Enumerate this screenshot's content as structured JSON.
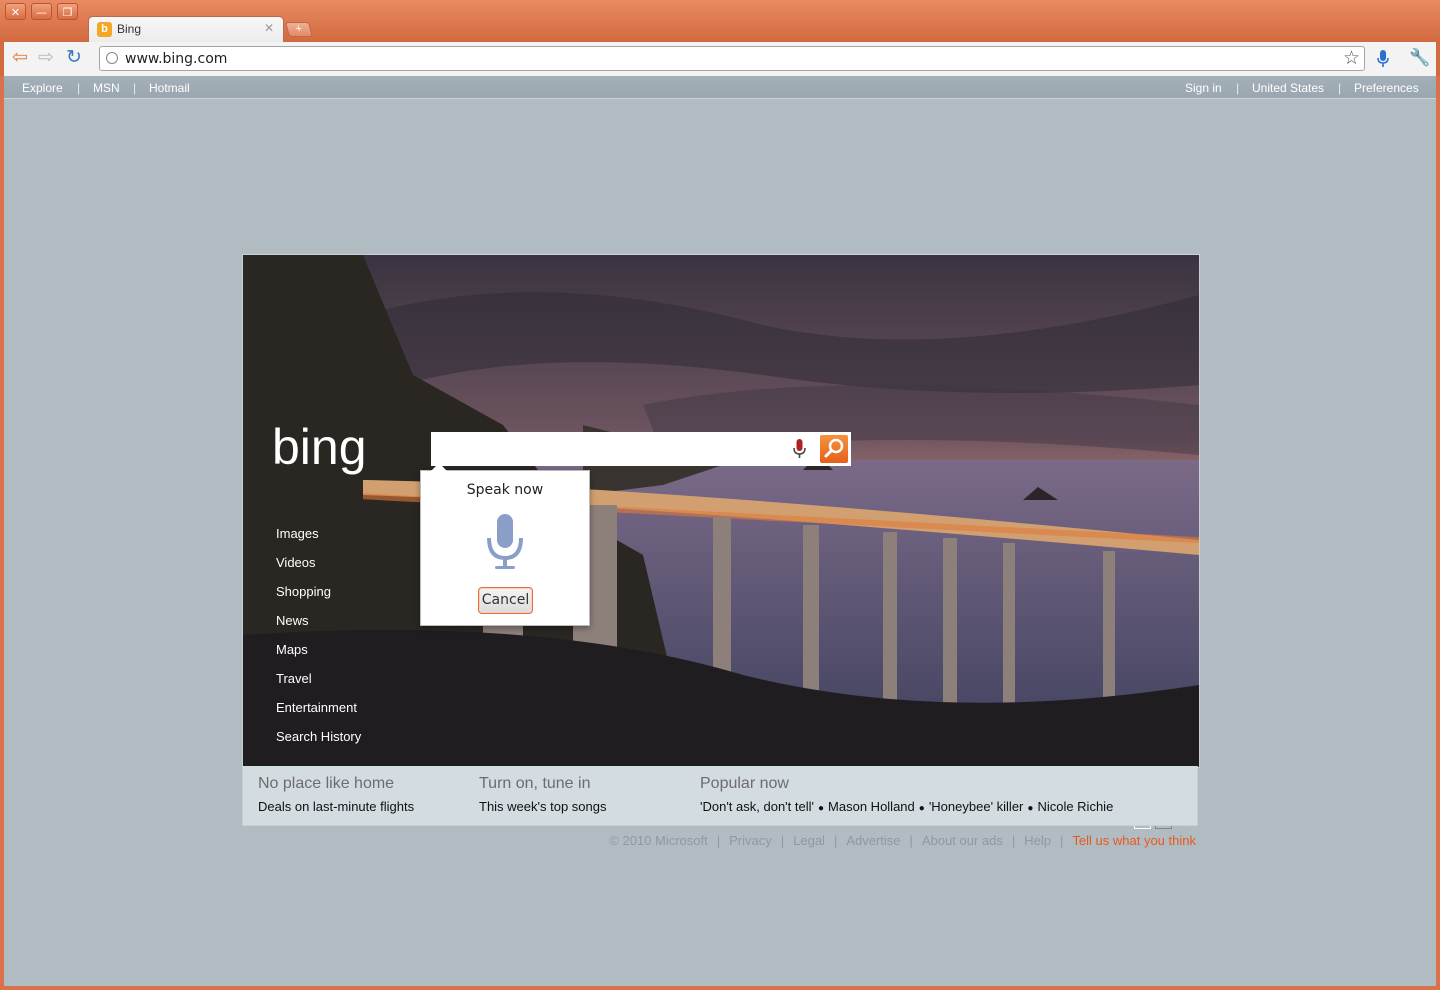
{
  "browser": {
    "tab": {
      "title": "Bing",
      "favicon": "bing-favicon"
    },
    "url": "www.bing.com",
    "accent": "#d26a3f"
  },
  "topnav": {
    "left": [
      "Explore",
      "MSN",
      "Hotmail"
    ],
    "right": [
      "Sign in",
      "United States",
      "Preferences"
    ]
  },
  "bing": {
    "logo": "bing",
    "search": {
      "value": "",
      "placeholder": ""
    },
    "left_nav": [
      "Images",
      "Videos",
      "Shopping",
      "News",
      "Maps",
      "Travel",
      "Entertainment",
      "Search History"
    ]
  },
  "voice_popup": {
    "title": "Speak now",
    "cancel": "Cancel"
  },
  "infobar": [
    {
      "heading": "No place like home",
      "link": "Deals on last-minute flights"
    },
    {
      "heading": "Turn on, tune in",
      "link": "This week's top songs"
    },
    {
      "heading": "Popular now",
      "links": [
        "'Don't ask, don't tell'",
        "Mason Holland",
        "'Honeybee' killer",
        "Nicole Richie"
      ]
    }
  ],
  "footer": {
    "copyright": "© 2010 Microsoft",
    "links": [
      "Privacy",
      "Legal",
      "Advertise",
      "About our ads",
      "Help"
    ],
    "feedback": "Tell us what you think",
    "feedback_color": "#e8591f"
  },
  "hero_controls": {
    "prev": "◄",
    "next": "►",
    "copyright_glyph": "©"
  }
}
